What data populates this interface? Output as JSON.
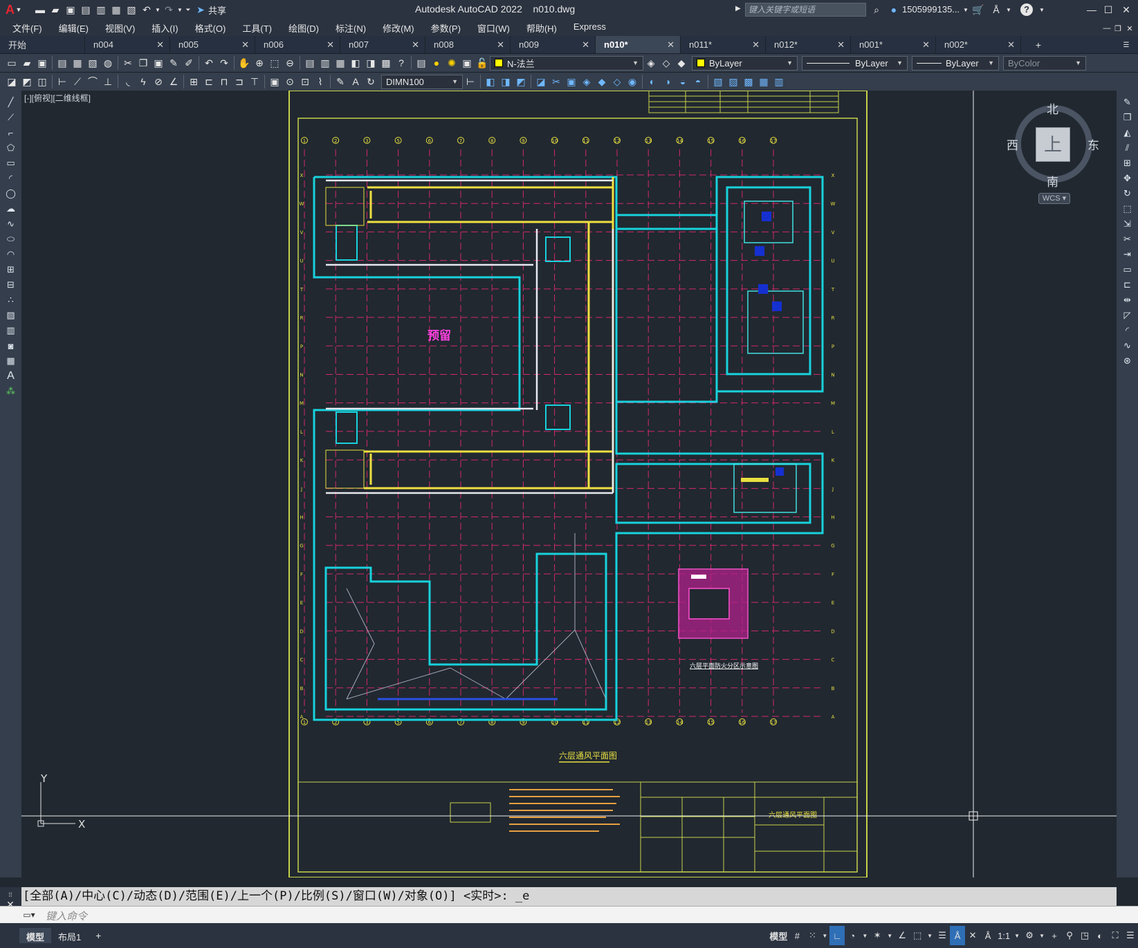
{
  "app": {
    "logo": "A",
    "title": "Autodesk AutoCAD 2022",
    "file": "n010.dwg",
    "share_label": "共享",
    "search_placeholder": "键入关键字或短语",
    "user": "1505999135...",
    "help": "?"
  },
  "menu": [
    "文件(F)",
    "编辑(E)",
    "视图(V)",
    "插入(I)",
    "格式(O)",
    "工具(T)",
    "绘图(D)",
    "标注(N)",
    "修改(M)",
    "参数(P)",
    "窗口(W)",
    "帮助(H)",
    "Express"
  ],
  "tabs": [
    {
      "label": "开始",
      "closable": false,
      "active": false
    },
    {
      "label": "n004",
      "closable": true,
      "active": false
    },
    {
      "label": "n005",
      "closable": true,
      "active": false
    },
    {
      "label": "n006",
      "closable": true,
      "active": false
    },
    {
      "label": "n007",
      "closable": true,
      "active": false
    },
    {
      "label": "n008",
      "closable": true,
      "active": false
    },
    {
      "label": "n009",
      "closable": true,
      "active": false
    },
    {
      "label": "n010*",
      "closable": true,
      "active": true
    },
    {
      "label": "n011*",
      "closable": true,
      "active": false
    },
    {
      "label": "n012*",
      "closable": true,
      "active": false
    },
    {
      "label": "n001*",
      "closable": true,
      "active": false
    },
    {
      "label": "n002*",
      "closable": true,
      "active": false
    }
  ],
  "toolbar1": {
    "layer": "N-法兰",
    "layer_color": "#ffff00",
    "color": "ByLayer",
    "linetype": "ByLayer",
    "lineweight": "ByLayer",
    "plotstyle": "ByColor"
  },
  "toolbar2": {
    "dimstyle": "DIMN100"
  },
  "viewport": {
    "label": "[-][俯视][二维线框]"
  },
  "viewcube": {
    "north": "北",
    "south": "南",
    "east": "东",
    "west": "西",
    "face": "上",
    "wcs": "WCS"
  },
  "drawing": {
    "reserved_label": "预留",
    "plan_title": "六层通风平面图",
    "small_plan_title": "六层平面防火分区示意图",
    "titleblock_name": "六层通风平面图",
    "column_labels": [
      "1",
      "2",
      "3",
      "5",
      "6",
      "7",
      "8",
      "9",
      "10",
      "11",
      "12",
      "13",
      "14",
      "15",
      "16",
      "17"
    ],
    "row_labels": [
      "X",
      "W",
      "V",
      "U",
      "T",
      "R",
      "P",
      "N",
      "M",
      "L",
      "K",
      "J",
      "H",
      "G",
      "F",
      "E",
      "D",
      "C",
      "B",
      "A"
    ]
  },
  "command": {
    "history": "[全部(A)/中心(C)/动态(D)/范围(E)/上一个(P)/比例(S)/窗口(W)/对象(O)] <实时>: _e",
    "placeholder": "键入命令"
  },
  "status": {
    "layout_tabs": [
      "模型",
      "布局1"
    ],
    "model_label": "模型",
    "scale": "1:1"
  },
  "ucs": {
    "x": "X",
    "y": "Y"
  }
}
